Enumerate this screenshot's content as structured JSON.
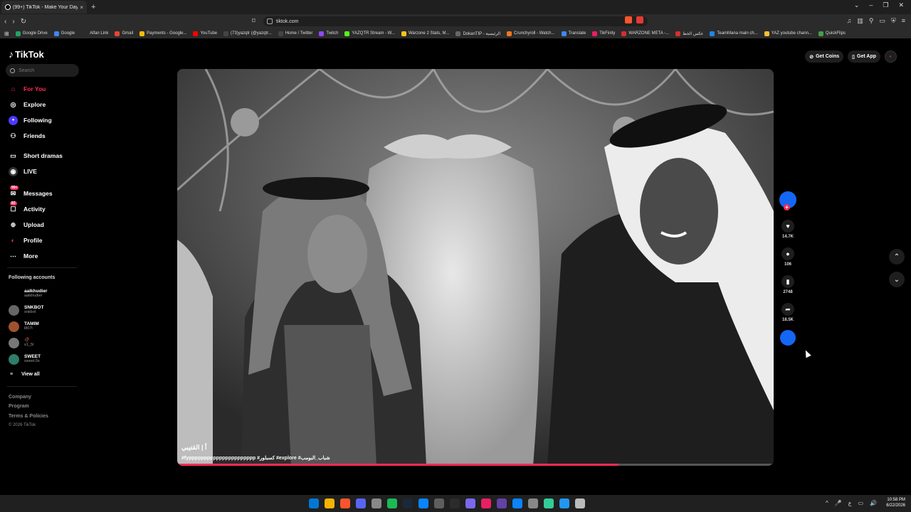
{
  "browser": {
    "tab_title": "(99+) TikTok - Make Your Day",
    "tab_close": "×",
    "new_tab": "+",
    "url": "tiktok.com",
    "window_controls": [
      "⌄",
      "–",
      "❐",
      "✕"
    ],
    "bookmarks": [
      {
        "label": "Google Drive",
        "color": "#1fa463"
      },
      {
        "label": "Google",
        "color": "#4285f4"
      },
      {
        "label": "Alfan Link",
        "color": "#000000"
      },
      {
        "label": "Gmail",
        "color": "#ea4335"
      },
      {
        "label": "Payments - Google...",
        "color": "#fbbc04"
      },
      {
        "label": "YouTube",
        "color": "#ff0000"
      },
      {
        "label": "(73)yazqtr (@yazqtr...",
        "color": "#000000"
      },
      {
        "label": "Home / Twitter",
        "color": "#000000"
      },
      {
        "label": "Twitch",
        "color": "#9146ff"
      },
      {
        "label": "YAZQTR Stream - W...",
        "color": "#53fc18"
      },
      {
        "label": "Warzone 2 Stats, M...",
        "color": "#f5c518"
      },
      {
        "label": "DokanTIP - الرئيسية",
        "color": "#333333"
      },
      {
        "label": "Crunchyroll - Watch...",
        "color": "#f47521"
      },
      {
        "label": "Translate",
        "color": "#4285f4"
      },
      {
        "label": "TikFinity",
        "color": "#e91e63"
      },
      {
        "label": "WARZONE META -...",
        "color": "#d32f2f"
      },
      {
        "label": "عكس الخط",
        "color": "#d32f2f"
      },
      {
        "label": "TeamMana main ch...",
        "color": "#1e88e5"
      },
      {
        "label": "YAZ youtube chann...",
        "color": "#fbc02d"
      },
      {
        "label": "QuickFlips",
        "color": "#43a047"
      }
    ]
  },
  "tiktok": {
    "logo": "TikTok",
    "search_placeholder": "Search",
    "nav": [
      {
        "label": "For You",
        "icon": "home-icon",
        "glyph": "⌂",
        "active": true
      },
      {
        "label": "Explore",
        "icon": "compass-icon",
        "glyph": "◎"
      },
      {
        "label": "Following",
        "icon": "following-icon",
        "glyph": "●"
      },
      {
        "label": "Friends",
        "icon": "friends-icon",
        "glyph": "👥"
      },
      {
        "label": "Short dramas",
        "icon": "drama-icon",
        "glyph": "▭"
      },
      {
        "label": "LIVE",
        "icon": "live-icon",
        "glyph": "◉"
      },
      {
        "label": "Messages",
        "icon": "messages-icon",
        "glyph": "✉",
        "badge": "99+"
      },
      {
        "label": "Activity",
        "icon": "activity-icon",
        "glyph": "☐",
        "badge": "83"
      },
      {
        "label": "Upload",
        "icon": "upload-icon",
        "glyph": "⊕"
      },
      {
        "label": "Profile",
        "icon": "profile-icon",
        "glyph": "◐"
      },
      {
        "label": "More",
        "icon": "more-icon",
        "glyph": "⋯"
      }
    ],
    "following_title": "Following accounts",
    "following": [
      {
        "name": "aalkhudier",
        "handle": "aalkhudier",
        "color": "#000000"
      },
      {
        "name": "SNKBOT",
        "handle": "snkbot",
        "color": "#666666"
      },
      {
        "name": "TAMIM",
        "handle": "l807l",
        "color": "#a0522d"
      },
      {
        "name": "🥀",
        "handle": "s1_5l",
        "color": "#777777"
      },
      {
        "name": "SWEET",
        "handle": "sweet.0x",
        "color": "#2e7d6a"
      }
    ],
    "view_all": "View all",
    "footer": [
      "Company",
      "Program",
      "Terms & Policies"
    ],
    "copyright": "© 2026 TikTok",
    "get_coins": "Get Coins",
    "get_app": "Get App",
    "video": {
      "author_caption": "أ | القتيبي",
      "hashtags": "#fypppppppppppppppppppppp #كسبلور #explore #شباب_البومب",
      "progress": 0.74
    },
    "actions": {
      "likes": "14.7K",
      "comments": "106",
      "saves": "2748",
      "shares": "18.5K"
    }
  },
  "taskbar": {
    "icon_colors": [
      "#0078d4",
      "#f4b400",
      "#fb542b",
      "#5865f2",
      "#888888",
      "#1db954",
      "#1b2838",
      "#0a84ff",
      "#5e5e5e",
      "#2b2b2b",
      "#7b68ee",
      "#e91e63",
      "#6441a5",
      "#0a84ff",
      "#888888",
      "#3c9",
      "#2196f3",
      "#bbbbbb"
    ],
    "tray": [
      "^",
      "🎤",
      "ع",
      "▭",
      "🔊"
    ],
    "time": "10:58 PM",
    "date": "6/22/2026"
  }
}
